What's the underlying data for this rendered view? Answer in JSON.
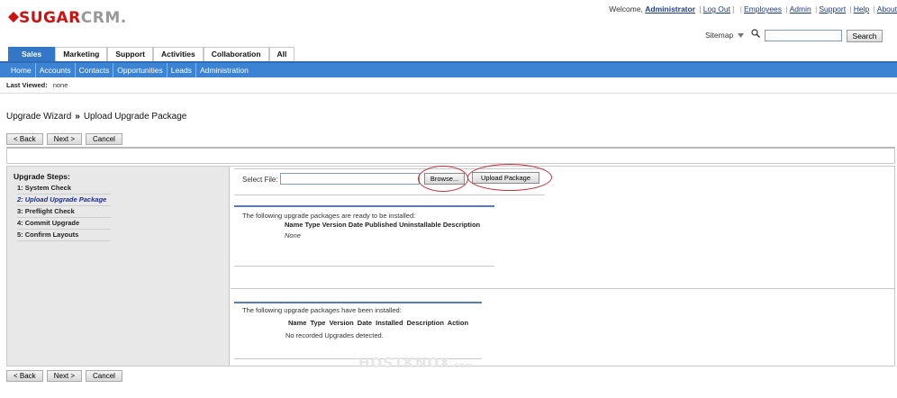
{
  "header": {
    "logo_left": "SUGAR",
    "logo_right": "CRM.",
    "welcome_prefix": "Welcome, ",
    "user": "Administrator",
    "logout": "Log Out",
    "links": [
      "Employees",
      "Admin",
      "Support",
      "Help",
      "About"
    ],
    "sitemap": "Sitemap",
    "search_value": "",
    "search_button": "Search"
  },
  "tabs": [
    {
      "label": "Sales",
      "active": true
    },
    {
      "label": "Marketing"
    },
    {
      "label": "Support"
    },
    {
      "label": "Activities"
    },
    {
      "label": "Collaboration"
    },
    {
      "label": "All"
    }
  ],
  "subnav": [
    "Home",
    "Accounts",
    "Contacts",
    "Opportunities",
    "Leads",
    "Administration"
  ],
  "last_viewed": {
    "label": "Last Viewed:",
    "value": "none"
  },
  "page_title": {
    "part1": "Upgrade Wizard",
    "arrow": "»",
    "part2": "Upload Upgrade Package"
  },
  "buttons": {
    "back": "< Back",
    "next": "Next >",
    "cancel": "Cancel"
  },
  "steps": {
    "title": "Upgrade Steps:",
    "items": [
      "1: System Check",
      "2: Upload Upgrade Package",
      "3: Preflight Check",
      "4: Commit Upgrade",
      "5: Confirm Layouts"
    ],
    "current_index": 1
  },
  "upload": {
    "select_label": "Select File:",
    "file_value": "",
    "browse": "Browse...",
    "upload_package": "Upload Package"
  },
  "ready": {
    "text": "The following upgrade packages are ready to be installed:",
    "columns": [
      "Name",
      "Type",
      "Version",
      "Date Published",
      "Uninstallable",
      "Description"
    ],
    "empty": "None"
  },
  "installed": {
    "text": "The following upgrade packages have been installed:",
    "columns": [
      "Name",
      "Type",
      "Version",
      "Date Installed",
      "Description",
      "Action"
    ],
    "empty": "No recorded Upgrades detected."
  },
  "watermark": "HOSTKNOX",
  "watermark_suffix": ".com",
  "colors": {
    "brand_red": "#cc1111",
    "nav_blue": "#3c83d4",
    "active_tab": "#3477c7",
    "highlight_ring": "#c0303a"
  }
}
